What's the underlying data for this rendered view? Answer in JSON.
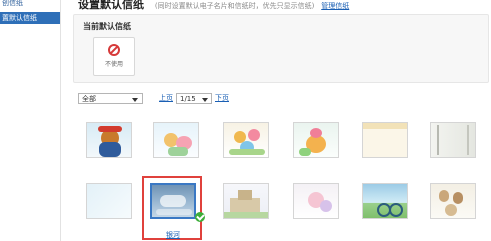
{
  "sidebar": {
    "items": [
      {
        "label": "创信纸"
      },
      {
        "label": "置默认信纸"
      }
    ]
  },
  "header": {
    "title": "设置默认信纸",
    "description": "(同时设置默认电子名片和信纸时，优先只显示信纸)",
    "link": "管理信纸"
  },
  "current": {
    "label": "当前默认信纸",
    "box_text": "不使用"
  },
  "filter": {
    "selected": "全部",
    "prev": "上页",
    "page": "1/15",
    "next": "下页"
  },
  "selected_label": "银河",
  "colors": {
    "accent": "#2e6fb8",
    "selection_border": "#e0413c",
    "check": "#3dae3a",
    "link": "#1a5fb4"
  }
}
